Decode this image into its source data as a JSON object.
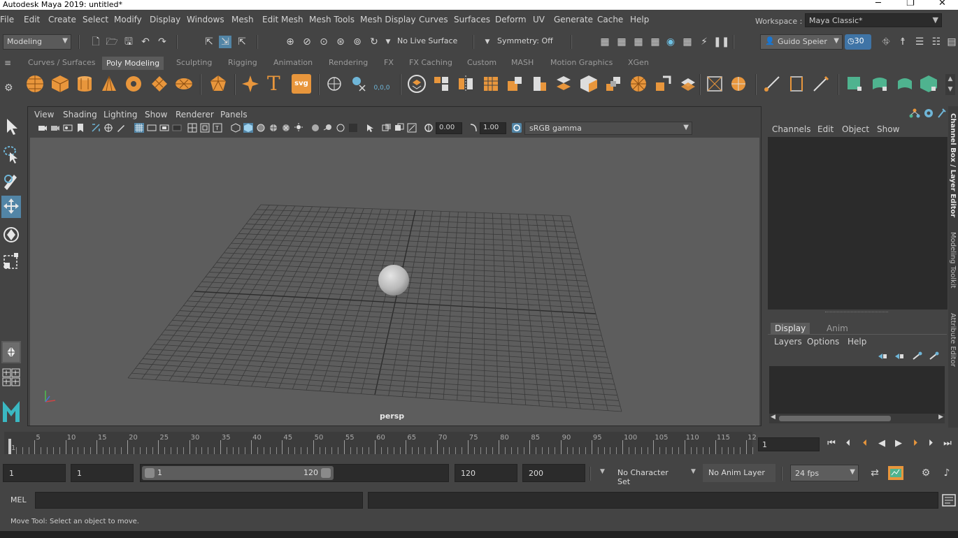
{
  "window": {
    "title": "Autodesk Maya 2019: untitled*"
  },
  "menubar": {
    "items": [
      "File",
      "Edit",
      "Create",
      "Select",
      "Modify",
      "Display",
      "Windows",
      "Mesh",
      "Edit Mesh",
      "Mesh Tools",
      "Mesh Display",
      "Curves",
      "Surfaces",
      "Deform",
      "UV",
      "Generate",
      "Cache",
      "Help"
    ],
    "workspace_label": "Workspace :",
    "workspace_value": "Maya Classic*"
  },
  "statusline": {
    "menuset": "Modeling",
    "live_surface": "No Live Surface",
    "symmetry": "Symmetry: Off",
    "user": "Guido Speier",
    "badge": "30"
  },
  "shelf": {
    "tabs": [
      "Curves / Surfaces",
      "Poly Modeling",
      "Sculpting",
      "Rigging",
      "Animation",
      "Rendering",
      "FX",
      "FX Caching",
      "Custom",
      "MASH",
      "Motion Graphics",
      "XGen"
    ],
    "active_tab": "Poly Modeling",
    "svg_label": "svg",
    "text_label": "T",
    "poly_count": "0,0,0"
  },
  "viewport": {
    "menus": [
      "View",
      "Shading",
      "Lighting",
      "Show",
      "Renderer",
      "Panels"
    ],
    "exposure": "0.00",
    "gamma": "1.00",
    "color_space": "sRGB gamma",
    "camera": "persp"
  },
  "channelbox": {
    "menus": [
      "Channels",
      "Edit",
      "Object",
      "Show"
    ],
    "side_tabs": [
      "Channel Box / Layer Editor",
      "Modeling Toolkit",
      "Attribute Editor"
    ]
  },
  "layereditor": {
    "tabs": [
      "Display",
      "Anim"
    ],
    "active_tab": "Display",
    "menus": [
      "Layers",
      "Options",
      "Help"
    ]
  },
  "timeslider": {
    "labels": [
      "1",
      "5",
      "10",
      "15",
      "20",
      "25",
      "30",
      "35",
      "40",
      "45",
      "50",
      "55",
      "60",
      "65",
      "70",
      "75",
      "80",
      "85",
      "90",
      "95",
      "100",
      "105",
      "110",
      "115",
      "12"
    ],
    "current_frame": "1"
  },
  "range": {
    "start": "1",
    "playback_start": "1",
    "handle_start": "1",
    "handle_end": "120",
    "playback_end": "120",
    "end": "200",
    "character_set": "No Character Set",
    "anim_layer": "No Anim Layer",
    "fps": "24 fps"
  },
  "cmdline": {
    "label": "MEL"
  },
  "helpline": {
    "text": "Move Tool: Select an object to move."
  },
  "colors": {
    "accent_orange": "#e8963c",
    "accent_teal": "#4fb38f",
    "active_blue": "#5285a6"
  }
}
